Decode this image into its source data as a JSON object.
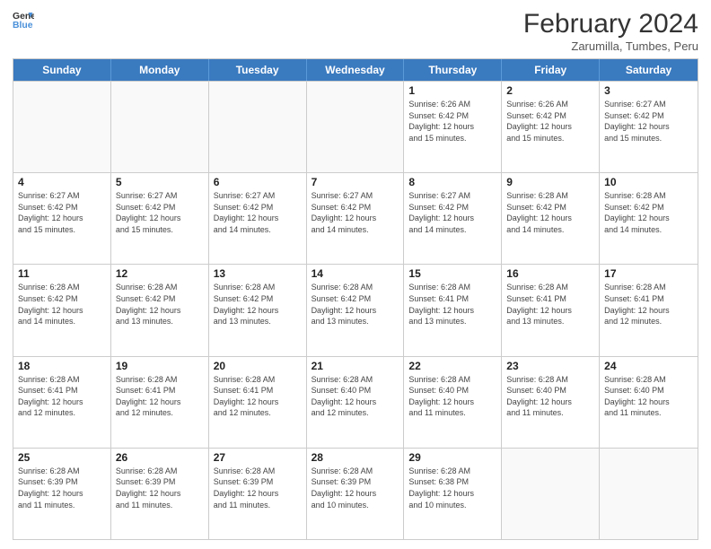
{
  "header": {
    "logo_line1": "General",
    "logo_line2": "Blue",
    "month": "February 2024",
    "location": "Zarumilla, Tumbes, Peru"
  },
  "weekdays": [
    "Sunday",
    "Monday",
    "Tuesday",
    "Wednesday",
    "Thursday",
    "Friday",
    "Saturday"
  ],
  "rows": [
    [
      {
        "day": "",
        "info": ""
      },
      {
        "day": "",
        "info": ""
      },
      {
        "day": "",
        "info": ""
      },
      {
        "day": "",
        "info": ""
      },
      {
        "day": "1",
        "info": "Sunrise: 6:26 AM\nSunset: 6:42 PM\nDaylight: 12 hours\nand 15 minutes."
      },
      {
        "day": "2",
        "info": "Sunrise: 6:26 AM\nSunset: 6:42 PM\nDaylight: 12 hours\nand 15 minutes."
      },
      {
        "day": "3",
        "info": "Sunrise: 6:27 AM\nSunset: 6:42 PM\nDaylight: 12 hours\nand 15 minutes."
      }
    ],
    [
      {
        "day": "4",
        "info": "Sunrise: 6:27 AM\nSunset: 6:42 PM\nDaylight: 12 hours\nand 15 minutes."
      },
      {
        "day": "5",
        "info": "Sunrise: 6:27 AM\nSunset: 6:42 PM\nDaylight: 12 hours\nand 15 minutes."
      },
      {
        "day": "6",
        "info": "Sunrise: 6:27 AM\nSunset: 6:42 PM\nDaylight: 12 hours\nand 14 minutes."
      },
      {
        "day": "7",
        "info": "Sunrise: 6:27 AM\nSunset: 6:42 PM\nDaylight: 12 hours\nand 14 minutes."
      },
      {
        "day": "8",
        "info": "Sunrise: 6:27 AM\nSunset: 6:42 PM\nDaylight: 12 hours\nand 14 minutes."
      },
      {
        "day": "9",
        "info": "Sunrise: 6:28 AM\nSunset: 6:42 PM\nDaylight: 12 hours\nand 14 minutes."
      },
      {
        "day": "10",
        "info": "Sunrise: 6:28 AM\nSunset: 6:42 PM\nDaylight: 12 hours\nand 14 minutes."
      }
    ],
    [
      {
        "day": "11",
        "info": "Sunrise: 6:28 AM\nSunset: 6:42 PM\nDaylight: 12 hours\nand 14 minutes."
      },
      {
        "day": "12",
        "info": "Sunrise: 6:28 AM\nSunset: 6:42 PM\nDaylight: 12 hours\nand 13 minutes."
      },
      {
        "day": "13",
        "info": "Sunrise: 6:28 AM\nSunset: 6:42 PM\nDaylight: 12 hours\nand 13 minutes."
      },
      {
        "day": "14",
        "info": "Sunrise: 6:28 AM\nSunset: 6:42 PM\nDaylight: 12 hours\nand 13 minutes."
      },
      {
        "day": "15",
        "info": "Sunrise: 6:28 AM\nSunset: 6:41 PM\nDaylight: 12 hours\nand 13 minutes."
      },
      {
        "day": "16",
        "info": "Sunrise: 6:28 AM\nSunset: 6:41 PM\nDaylight: 12 hours\nand 13 minutes."
      },
      {
        "day": "17",
        "info": "Sunrise: 6:28 AM\nSunset: 6:41 PM\nDaylight: 12 hours\nand 12 minutes."
      }
    ],
    [
      {
        "day": "18",
        "info": "Sunrise: 6:28 AM\nSunset: 6:41 PM\nDaylight: 12 hours\nand 12 minutes."
      },
      {
        "day": "19",
        "info": "Sunrise: 6:28 AM\nSunset: 6:41 PM\nDaylight: 12 hours\nand 12 minutes."
      },
      {
        "day": "20",
        "info": "Sunrise: 6:28 AM\nSunset: 6:41 PM\nDaylight: 12 hours\nand 12 minutes."
      },
      {
        "day": "21",
        "info": "Sunrise: 6:28 AM\nSunset: 6:40 PM\nDaylight: 12 hours\nand 12 minutes."
      },
      {
        "day": "22",
        "info": "Sunrise: 6:28 AM\nSunset: 6:40 PM\nDaylight: 12 hours\nand 11 minutes."
      },
      {
        "day": "23",
        "info": "Sunrise: 6:28 AM\nSunset: 6:40 PM\nDaylight: 12 hours\nand 11 minutes."
      },
      {
        "day": "24",
        "info": "Sunrise: 6:28 AM\nSunset: 6:40 PM\nDaylight: 12 hours\nand 11 minutes."
      }
    ],
    [
      {
        "day": "25",
        "info": "Sunrise: 6:28 AM\nSunset: 6:39 PM\nDaylight: 12 hours\nand 11 minutes."
      },
      {
        "day": "26",
        "info": "Sunrise: 6:28 AM\nSunset: 6:39 PM\nDaylight: 12 hours\nand 11 minutes."
      },
      {
        "day": "27",
        "info": "Sunrise: 6:28 AM\nSunset: 6:39 PM\nDaylight: 12 hours\nand 11 minutes."
      },
      {
        "day": "28",
        "info": "Sunrise: 6:28 AM\nSunset: 6:39 PM\nDaylight: 12 hours\nand 10 minutes."
      },
      {
        "day": "29",
        "info": "Sunrise: 6:28 AM\nSunset: 6:38 PM\nDaylight: 12 hours\nand 10 minutes."
      },
      {
        "day": "",
        "info": ""
      },
      {
        "day": "",
        "info": ""
      }
    ]
  ]
}
